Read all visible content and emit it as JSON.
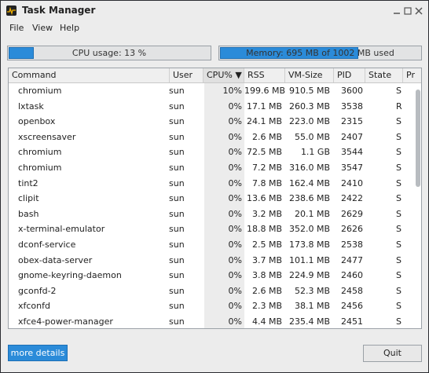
{
  "window": {
    "title": "Task Manager",
    "icon": "task-manager-icon"
  },
  "menu": [
    "File",
    "View",
    "Help"
  ],
  "cpu": {
    "label": "CPU usage: 13 %",
    "fraction": 0.13
  },
  "memory": {
    "label": "Memory: 695 MB of 1002 MB used",
    "fraction": 0.694
  },
  "table": {
    "columns": [
      "Command",
      "User",
      "CPU% ▼",
      "RSS",
      "VM-Size",
      "PID",
      "State",
      "Pr"
    ],
    "rows": [
      [
        "chromium",
        "sun",
        "10%",
        "199.6 MB",
        "910.5 MB",
        "3600",
        "S"
      ],
      [
        "lxtask",
        "sun",
        "0%",
        "17.1 MB",
        "260.3 MB",
        "3538",
        "R"
      ],
      [
        "openbox",
        "sun",
        "0%",
        "24.1 MB",
        "223.0 MB",
        "2315",
        "S"
      ],
      [
        "xscreensaver",
        "sun",
        "0%",
        "2.6 MB",
        "55.0 MB",
        "2407",
        "S"
      ],
      [
        "chromium",
        "sun",
        "0%",
        "72.5 MB",
        "1.1 GB",
        "3544",
        "S"
      ],
      [
        "chromium",
        "sun",
        "0%",
        "7.2 MB",
        "316.0 MB",
        "3547",
        "S"
      ],
      [
        "tint2",
        "sun",
        "0%",
        "7.8 MB",
        "162.4 MB",
        "2410",
        "S"
      ],
      [
        "clipit",
        "sun",
        "0%",
        "13.6 MB",
        "238.6 MB",
        "2422",
        "S"
      ],
      [
        "bash",
        "sun",
        "0%",
        "3.2 MB",
        "20.1 MB",
        "2629",
        "S"
      ],
      [
        "x-terminal-emulator",
        "sun",
        "0%",
        "18.8 MB",
        "352.0 MB",
        "2626",
        "S"
      ],
      [
        "dconf-service",
        "sun",
        "0%",
        "2.5 MB",
        "173.8 MB",
        "2538",
        "S"
      ],
      [
        "obex-data-server",
        "sun",
        "0%",
        "3.7 MB",
        "101.1 MB",
        "2477",
        "S"
      ],
      [
        "gnome-keyring-daemon",
        "sun",
        "0%",
        "3.8 MB",
        "224.9 MB",
        "2460",
        "S"
      ],
      [
        "gconfd-2",
        "sun",
        "0%",
        "2.6 MB",
        "52.3 MB",
        "2458",
        "S"
      ],
      [
        "xfconfd",
        "sun",
        "0%",
        "2.3 MB",
        "38.1 MB",
        "2456",
        "S"
      ],
      [
        "xfce4-power-manager",
        "sun",
        "0%",
        "4.4 MB",
        "235.4 MB",
        "2451",
        "S"
      ]
    ]
  },
  "buttons": {
    "more": "more details",
    "quit": "Quit"
  },
  "colors": {
    "accent": "#2b8bd9",
    "window": "#ececec"
  }
}
